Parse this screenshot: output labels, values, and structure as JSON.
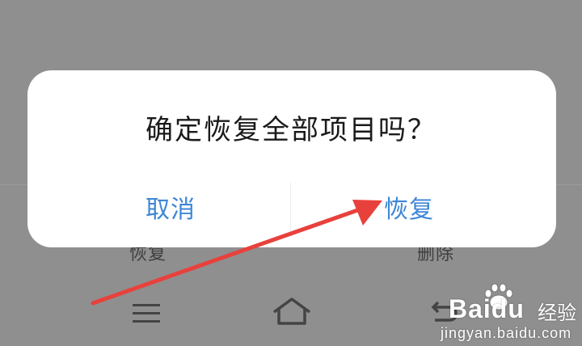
{
  "background_screen": {
    "restore_label": "恢复",
    "delete_label": "删除"
  },
  "dialog": {
    "title": "确定恢复全部项目吗？",
    "cancel_label": "取消",
    "confirm_label": "恢复",
    "accent_color": "#3d86d6"
  },
  "annotation": {
    "arrow_color": "#e8413c",
    "points_to": "confirm_label"
  },
  "navigation_bar": {
    "icons": [
      "menu-icon",
      "home-icon",
      "back-icon"
    ]
  },
  "watermark": {
    "brand": "Baidu",
    "brand_cn": "经验",
    "url": "jingyan.baidu.com"
  }
}
